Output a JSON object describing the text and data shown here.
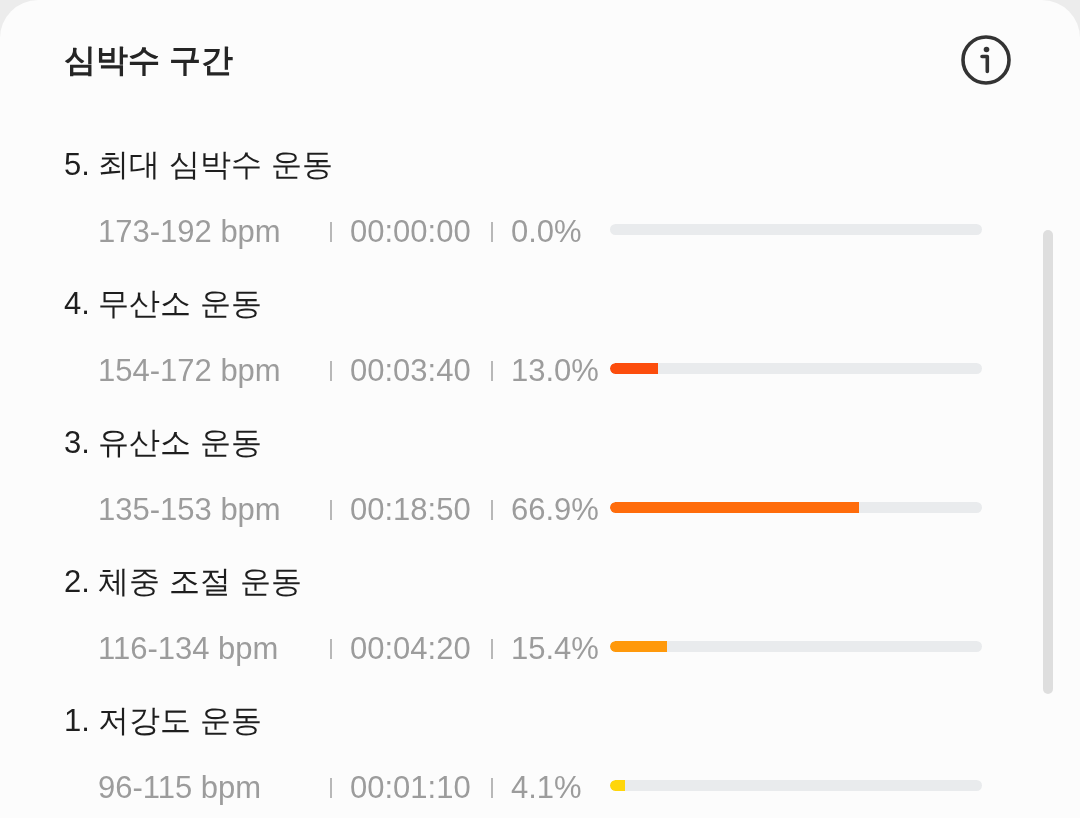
{
  "card": {
    "title": "심박수 구간"
  },
  "zones": [
    {
      "name": "5. 최대 심박수 운동",
      "range": "173-192 bpm",
      "duration": "00:00:00",
      "percent": "0.0%"
    },
    {
      "name": "4. 무산소 운동",
      "range": "154-172 bpm",
      "duration": "00:03:40",
      "percent": "13.0%",
      "level": 0.13,
      "color": "#fc4d0d"
    },
    {
      "name": "3. 유산소 운동",
      "range": "135-153 bpm",
      "duration": "00:18:50",
      "percent": "66.9%",
      "level": 0.669,
      "color": "#ff6c0b"
    },
    {
      "name": "2. 체중 조절 운동",
      "range": "116-134 bpm",
      "duration": "00:04:20",
      "percent": "15.4%",
      "level": 0.154,
      "color": "#ff990b"
    },
    {
      "name": "1. 저강도 운동",
      "range": "96-115 bpm",
      "duration": "00:01:10",
      "percent": "4.1%",
      "level": 0.041,
      "color": "#ffd60a"
    }
  ]
}
